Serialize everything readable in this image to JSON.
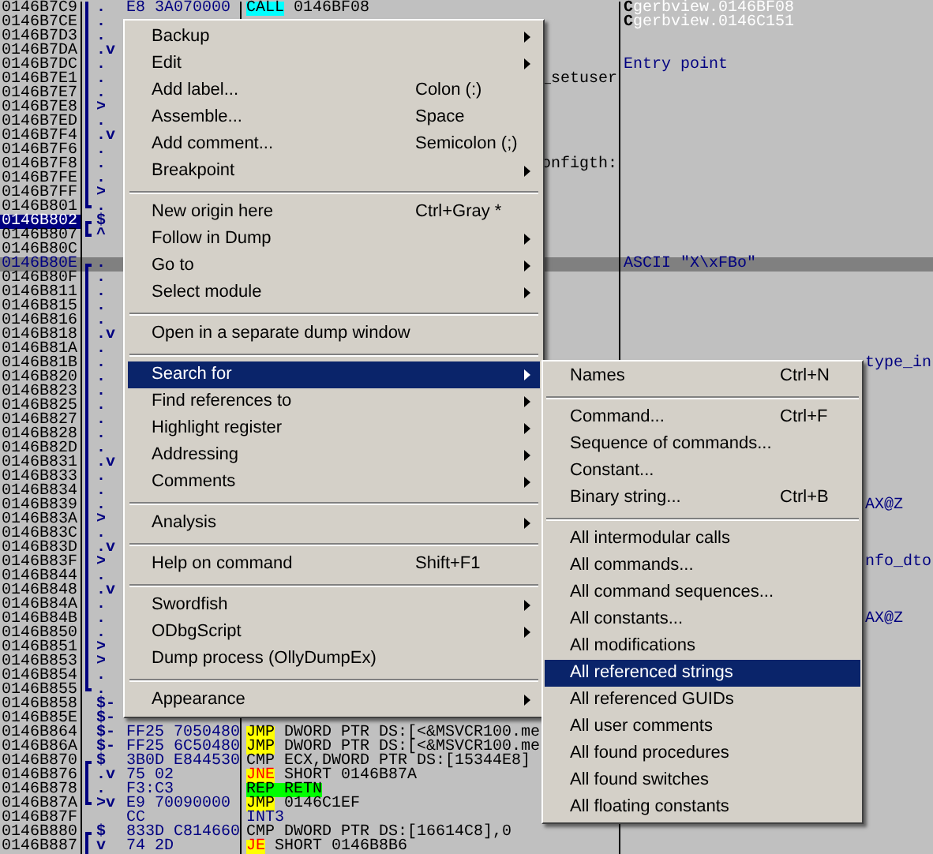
{
  "rows": [
    {
      "address": "0146B7C9",
      "mark": ".",
      "bracket": {
        "kind": "mid"
      },
      "hex": "E8 3A070000",
      "mnemonic": {
        "text": "CALL",
        "kind": "call"
      },
      "operands": "0146BF08",
      "comment_prefix": "C",
      "comment": "gerbview.0146BF08",
      "selected": false,
      "highlighted": false
    },
    {
      "address": "0146B7CE",
      "mark": ".",
      "bracket": {
        "kind": "mid"
      },
      "comment_prefix": "C",
      "comment": "gerbview.0146C151",
      "selected": false,
      "highlighted": false
    },
    {
      "address": "0146B7D3",
      "mark": ".",
      "bracket": {
        "kind": "mid"
      },
      "selected": false,
      "highlighted": false
    },
    {
      "address": "0146B7DA",
      "mark": ".v",
      "bracket": {
        "kind": "mid"
      },
      "selected": false,
      "highlighted": false
    },
    {
      "address": "0146B7DC",
      "mark": ".",
      "bracket": {
        "kind": "mid"
      },
      "comment": "Entry point",
      "selected": false,
      "highlighted": false
    },
    {
      "address": "0146B7E1",
      "mark": ".",
      "bracket": {
        "kind": "mid"
      },
      "disasm_tail": "_setuser",
      "selected": false,
      "highlighted": false
    },
    {
      "address": "0146B7E7",
      "mark": ".",
      "bracket": {
        "kind": "mid"
      },
      "selected": false,
      "highlighted": false
    },
    {
      "address": "0146B7E8",
      "mark": ">",
      "bracket": {
        "kind": "mid"
      },
      "selected": false,
      "highlighted": false
    },
    {
      "address": "0146B7ED",
      "mark": ".",
      "bracket": {
        "kind": "mid"
      },
      "selected": false,
      "highlighted": false
    },
    {
      "address": "0146B7F4",
      "mark": ".v",
      "bracket": {
        "kind": "mid"
      },
      "selected": false,
      "highlighted": false
    },
    {
      "address": "0146B7F6",
      "mark": ".",
      "bracket": {
        "kind": "mid"
      },
      "selected": false,
      "highlighted": false
    },
    {
      "address": "0146B7F8",
      "mark": ".",
      "bracket": {
        "kind": "mid"
      },
      "disasm_tail": "onfigth:",
      "selected": false,
      "highlighted": false
    },
    {
      "address": "0146B7FE",
      "mark": ".",
      "bracket": {
        "kind": "mid"
      },
      "selected": false,
      "highlighted": false
    },
    {
      "address": "0146B7FF",
      "mark": ">",
      "bracket": {
        "kind": "mid"
      },
      "selected": false,
      "highlighted": false
    },
    {
      "address": "0146B801",
      "mark": ".",
      "bracket": {
        "kind": "bottom"
      },
      "selected": false,
      "highlighted": false
    },
    {
      "address": "0146B802",
      "mark": "$",
      "bracket": {
        "kind": "top"
      },
      "selected": true,
      "highlighted": false
    },
    {
      "address": "0146B807",
      "mark": "^",
      "bracket": {
        "kind": "bottom"
      },
      "selected": false,
      "highlighted": false
    },
    {
      "address": "0146B80C",
      "selected": false,
      "highlighted": false
    },
    {
      "address": "0146B80E",
      "mark": ".",
      "bracket": {
        "kind": "top"
      },
      "comment": "ASCII \"X\\xFBo\"",
      "selected": false,
      "highlighted": true
    },
    {
      "address": "0146B80F",
      "mark": ".",
      "bracket": {
        "kind": "mid"
      },
      "selected": false,
      "highlighted": false
    },
    {
      "address": "0146B811",
      "mark": ".",
      "bracket": {
        "kind": "mid"
      },
      "selected": false,
      "highlighted": false
    },
    {
      "address": "0146B815",
      "mark": ".",
      "bracket": {
        "kind": "mid"
      },
      "selected": false,
      "highlighted": false
    },
    {
      "address": "0146B816",
      "mark": ".",
      "bracket": {
        "kind": "mid"
      },
      "selected": false,
      "highlighted": false
    },
    {
      "address": "0146B818",
      "mark": ".v",
      "bracket": {
        "kind": "mid"
      },
      "selected": false,
      "highlighted": false
    },
    {
      "address": "0146B81A",
      "mark": ".",
      "bracket": {
        "kind": "mid"
      },
      "selected": false,
      "highlighted": false
    },
    {
      "address": "0146B81B",
      "mark": ".",
      "bracket": {
        "kind": "mid"
      },
      "comment_tail": "type_in",
      "selected": false,
      "highlighted": false
    },
    {
      "address": "0146B820",
      "mark": ".",
      "bracket": {
        "kind": "mid"
      },
      "selected": false,
      "highlighted": false
    },
    {
      "address": "0146B823",
      "mark": ".",
      "bracket": {
        "kind": "mid"
      },
      "selected": false,
      "highlighted": false
    },
    {
      "address": "0146B825",
      "mark": ".",
      "bracket": {
        "kind": "mid"
      },
      "selected": false,
      "highlighted": false
    },
    {
      "address": "0146B827",
      "mark": ".",
      "bracket": {
        "kind": "mid"
      },
      "selected": false,
      "highlighted": false
    },
    {
      "address": "0146B828",
      "mark": ".",
      "bracket": {
        "kind": "mid"
      },
      "selected": false,
      "highlighted": false
    },
    {
      "address": "0146B82D",
      "mark": ".",
      "bracket": {
        "kind": "mid"
      },
      "selected": false,
      "highlighted": false
    },
    {
      "address": "0146B831",
      "mark": ".v",
      "bracket": {
        "kind": "mid"
      },
      "selected": false,
      "highlighted": false
    },
    {
      "address": "0146B833",
      "mark": ".",
      "bracket": {
        "kind": "mid"
      },
      "selected": false,
      "highlighted": false
    },
    {
      "address": "0146B834",
      "mark": ".",
      "bracket": {
        "kind": "mid"
      },
      "selected": false,
      "highlighted": false
    },
    {
      "address": "0146B839",
      "mark": ".",
      "bracket": {
        "kind": "mid"
      },
      "comment_tail": "AX@Z",
      "selected": false,
      "highlighted": false
    },
    {
      "address": "0146B83A",
      "mark": ">",
      "bracket": {
        "kind": "mid"
      },
      "selected": false,
      "highlighted": false
    },
    {
      "address": "0146B83C",
      "mark": ".",
      "bracket": {
        "kind": "mid"
      },
      "selected": false,
      "highlighted": false
    },
    {
      "address": "0146B83D",
      "mark": ".v",
      "bracket": {
        "kind": "mid"
      },
      "selected": false,
      "highlighted": false
    },
    {
      "address": "0146B83F",
      "mark": ">",
      "bracket": {
        "kind": "mid"
      },
      "comment_tail": "nfo_dto",
      "selected": false,
      "highlighted": false
    },
    {
      "address": "0146B844",
      "mark": ".",
      "bracket": {
        "kind": "mid"
      },
      "selected": false,
      "highlighted": false
    },
    {
      "address": "0146B848",
      "mark": ".v",
      "bracket": {
        "kind": "mid"
      },
      "selected": false,
      "highlighted": false
    },
    {
      "address": "0146B84A",
      "mark": ".",
      "bracket": {
        "kind": "mid"
      },
      "selected": false,
      "highlighted": false
    },
    {
      "address": "0146B84B",
      "mark": ".",
      "bracket": {
        "kind": "mid"
      },
      "comment_tail": "AX@Z",
      "selected": false,
      "highlighted": false
    },
    {
      "address": "0146B850",
      "mark": ".",
      "bracket": {
        "kind": "mid"
      },
      "selected": false,
      "highlighted": false
    },
    {
      "address": "0146B851",
      "mark": ">",
      "bracket": {
        "kind": "mid"
      },
      "selected": false,
      "highlighted": false
    },
    {
      "address": "0146B853",
      "mark": ">",
      "bracket": {
        "kind": "mid"
      },
      "selected": false,
      "highlighted": false
    },
    {
      "address": "0146B854",
      "mark": ".",
      "bracket": {
        "kind": "mid"
      },
      "selected": false,
      "highlighted": false
    },
    {
      "address": "0146B855",
      "mark": ".",
      "bracket": {
        "kind": "bottom"
      },
      "selected": false,
      "highlighted": false
    },
    {
      "address": "0146B858",
      "mark": "$-",
      "selected": false,
      "highlighted": false
    },
    {
      "address": "0146B85E",
      "mark": "$-",
      "selected": false,
      "highlighted": false
    },
    {
      "address": "0146B864",
      "mark": "$-",
      "hex": "FF25 7050480",
      "mnemonic": {
        "text": "JMP",
        "kind": "jump"
      },
      "operands": "DWORD PTR DS:[<&MSVCR100.me",
      "selected": false,
      "highlighted": false
    },
    {
      "address": "0146B86A",
      "mark": "$-",
      "hex": "FF25 6C50480",
      "mnemonic": {
        "text": "JMP",
        "kind": "jump"
      },
      "operands": "DWORD PTR DS:[<&MSVCR100.me",
      "selected": false,
      "highlighted": false
    },
    {
      "address": "0146B870",
      "mark": "$",
      "bracket": {
        "kind": "top"
      },
      "hex": "3B0D E844530",
      "mnemonic": {
        "text": "CMP",
        "kind": "plain"
      },
      "operands": "ECX,DWORD PTR DS:[15344E8]",
      "selected": false,
      "highlighted": false
    },
    {
      "address": "0146B876",
      "mark": ".v",
      "bracket": {
        "kind": "mid"
      },
      "hex": "75 02",
      "mnemonic": {
        "text": "JNE",
        "kind": "cond_jump"
      },
      "operands": "SHORT 0146B87A",
      "selected": false,
      "highlighted": false
    },
    {
      "address": "0146B878",
      "mark": ".",
      "bracket": {
        "kind": "mid"
      },
      "hex": "F3:C3",
      "mnemonic": {
        "text": "REP RETN",
        "kind": "return"
      },
      "selected": false,
      "highlighted": false
    },
    {
      "address": "0146B87A",
      "mark": ">v",
      "bracket": {
        "kind": "bottom"
      },
      "hex": "E9 70090000",
      "mnemonic": {
        "text": "JMP",
        "kind": "jump"
      },
      "operands": "0146C1EF",
      "selected": false,
      "highlighted": false
    },
    {
      "address": "0146B87F",
      "hex": "CC",
      "mnemonic": {
        "text": "INT3",
        "kind": "int"
      },
      "selected": false,
      "highlighted": false
    },
    {
      "address": "0146B880",
      "mark": "$",
      "bracket": {
        "kind": "top"
      },
      "hex": "833D C814660",
      "mnemonic": {
        "text": "CMP",
        "kind": "plain"
      },
      "operands": "DWORD PTR DS:[16614C8],0",
      "selected": false,
      "highlighted": false
    },
    {
      "address": "0146B887",
      "mark": "v",
      "bracket": {
        "kind": "mid"
      },
      "hex": "74 2D",
      "mnemonic": {
        "text": "JE",
        "kind": "cond_jump"
      },
      "operands": "SHORT 0146B8B6",
      "selected": false,
      "highlighted": false
    }
  ],
  "context_menu": [
    {
      "kind": "item",
      "label": "Backup",
      "submenu": true,
      "selected": false
    },
    {
      "kind": "item",
      "label": "Edit",
      "submenu": true,
      "selected": false
    },
    {
      "kind": "item",
      "label": "Add label...",
      "shortcut": "Colon (:)",
      "submenu": false,
      "selected": false
    },
    {
      "kind": "item",
      "label": "Assemble...",
      "shortcut": "Space",
      "submenu": false,
      "selected": false
    },
    {
      "kind": "item",
      "label": "Add comment...",
      "shortcut": "Semicolon (;)",
      "submenu": false,
      "selected": false
    },
    {
      "kind": "item",
      "label": "Breakpoint",
      "submenu": true,
      "selected": false
    },
    {
      "kind": "separator"
    },
    {
      "kind": "item",
      "label": "New origin here",
      "shortcut": "Ctrl+Gray *",
      "submenu": false,
      "selected": false
    },
    {
      "kind": "item",
      "label": "Follow in Dump",
      "submenu": true,
      "selected": false
    },
    {
      "kind": "item",
      "label": "Go to",
      "submenu": true,
      "selected": false
    },
    {
      "kind": "item",
      "label": "Select module",
      "submenu": true,
      "selected": false
    },
    {
      "kind": "separator"
    },
    {
      "kind": "item",
      "label": "Open in a separate dump window",
      "submenu": false,
      "selected": false
    },
    {
      "kind": "separator"
    },
    {
      "kind": "item",
      "label": "Search for",
      "submenu": true,
      "selected": true
    },
    {
      "kind": "item",
      "label": "Find references to",
      "submenu": true,
      "selected": false
    },
    {
      "kind": "item",
      "label": "Highlight register",
      "submenu": true,
      "selected": false
    },
    {
      "kind": "item",
      "label": "Addressing",
      "submenu": true,
      "selected": false
    },
    {
      "kind": "item",
      "label": "Comments",
      "submenu": true,
      "selected": false
    },
    {
      "kind": "separator"
    },
    {
      "kind": "item",
      "label": "Analysis",
      "submenu": true,
      "selected": false
    },
    {
      "kind": "separator"
    },
    {
      "kind": "item",
      "label": "Help on command",
      "shortcut": "Shift+F1",
      "submenu": false,
      "selected": false
    },
    {
      "kind": "separator"
    },
    {
      "kind": "item",
      "label": "Swordfish",
      "submenu": true,
      "selected": false
    },
    {
      "kind": "item",
      "label": "ODbgScript",
      "submenu": true,
      "selected": false
    },
    {
      "kind": "item",
      "label": "Dump process (OllyDumpEx)",
      "submenu": false,
      "selected": false
    },
    {
      "kind": "separator"
    },
    {
      "kind": "item",
      "label": "Appearance",
      "submenu": true,
      "selected": false
    }
  ],
  "search_submenu": [
    {
      "kind": "item",
      "label": "Names",
      "shortcut": "Ctrl+N",
      "selected": false
    },
    {
      "kind": "separator"
    },
    {
      "kind": "item",
      "label": "Command...",
      "shortcut": "Ctrl+F",
      "selected": false
    },
    {
      "kind": "item",
      "label": "Sequence of commands...",
      "selected": false
    },
    {
      "kind": "item",
      "label": "Constant...",
      "selected": false
    },
    {
      "kind": "item",
      "label": "Binary string...",
      "shortcut": "Ctrl+B",
      "selected": false
    },
    {
      "kind": "separator"
    },
    {
      "kind": "item",
      "label": "All intermodular calls",
      "selected": false
    },
    {
      "kind": "item",
      "label": "All commands...",
      "selected": false
    },
    {
      "kind": "item",
      "label": "All command sequences...",
      "selected": false
    },
    {
      "kind": "item",
      "label": "All constants...",
      "selected": false
    },
    {
      "kind": "item",
      "label": "All modifications",
      "selected": false
    },
    {
      "kind": "item",
      "label": "All referenced strings",
      "selected": true
    },
    {
      "kind": "item",
      "label": "All referenced GUIDs",
      "selected": false
    },
    {
      "kind": "item",
      "label": "All user comments",
      "selected": false
    },
    {
      "kind": "item",
      "label": "All found procedures",
      "selected": false
    },
    {
      "kind": "item",
      "label": "All found switches",
      "selected": false
    },
    {
      "kind": "item",
      "label": "All floating constants",
      "selected": false
    }
  ]
}
